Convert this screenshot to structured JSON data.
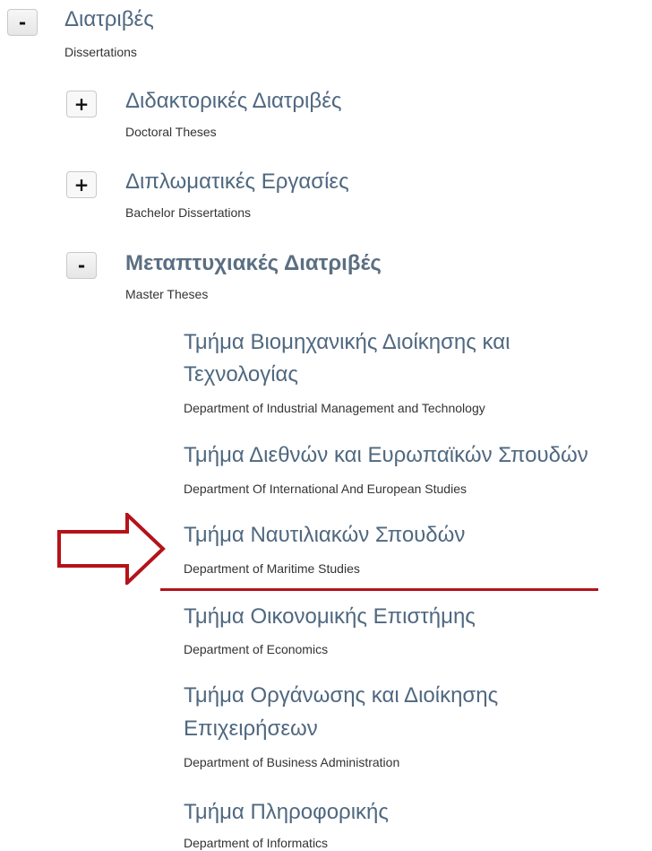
{
  "tree": {
    "root": {
      "toggle": "-",
      "title": "Διατριβές",
      "subtitle": "Dissertations"
    },
    "children": [
      {
        "toggle": "+",
        "title": "Διδακτορικές Διατριβές",
        "subtitle": "Doctoral Theses"
      },
      {
        "toggle": "+",
        "title": "Διπλωματικές Εργασίες",
        "subtitle": "Bachelor Dissertations"
      },
      {
        "toggle": "-",
        "title": "Μεταπτυχιακές Διατριβές",
        "subtitle": "Master Theses"
      }
    ],
    "departments": [
      {
        "title_line1": "Τμήμα Βιομηχανικής Διοίκησης και",
        "title_line2": "Τεχνολογίας",
        "subtitle": "Department of Industrial Management and Technology"
      },
      {
        "title": "Τμήμα Διεθνών και Ευρωπαϊκών Σπουδών",
        "subtitle": "Department Of International And European Studies"
      },
      {
        "title": "Τμήμα Ναυτιλιακών Σπουδών",
        "subtitle": "Department of Maritime Studies"
      },
      {
        "title": "Τμήμα Οικονομικής Επιστήμης",
        "subtitle": "Department of Economics"
      },
      {
        "title_line1": "Τμήμα Οργάνωσης και Διοίκησης",
        "title_line2": "Επιχειρήσεων",
        "subtitle": "Department of Business Administration"
      },
      {
        "title": "Τμήμα Πληροφορικής",
        "subtitle": "Department of Informatics"
      }
    ]
  },
  "annotation": {
    "color": "#b5121b"
  }
}
